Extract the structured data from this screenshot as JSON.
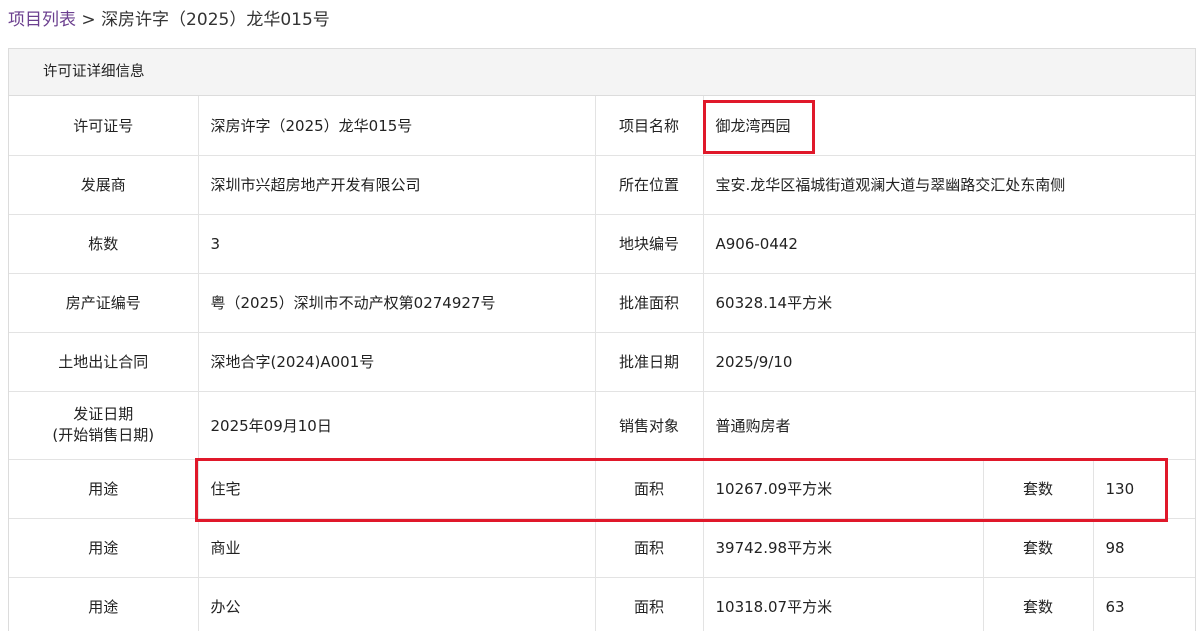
{
  "breadcrumb": {
    "link": "项目列表",
    "separator": ">",
    "current": "深房许字（2025）龙华015号"
  },
  "panel": {
    "title": "许可证详细信息"
  },
  "info_rows": [
    {
      "l1": "许可证号",
      "v1": "深房许字（2025）龙华015号",
      "l2": "项目名称",
      "v2": "御龙湾西园"
    },
    {
      "l1": "发展商",
      "v1": "深圳市兴超房地产开发有限公司",
      "l2": "所在位置",
      "v2": "宝安.龙华区福城街道观澜大道与翠幽路交汇处东南侧"
    },
    {
      "l1": "栋数",
      "v1": "3",
      "l2": "地块编号",
      "v2": "A906-0442"
    },
    {
      "l1": "房产证编号",
      "v1": "粤（2025）深圳市不动产权第0274927号",
      "l2": "批准面积",
      "v2": "60328.14平方米"
    },
    {
      "l1": "土地出让合同",
      "v1": "深地合字(2024)A001号",
      "l2": "批准日期",
      "v2": "2025/9/10"
    },
    {
      "l1": "发证日期",
      "l1b": "(开始销售日期)",
      "v1": "2025年09月10日",
      "l2": "销售对象",
      "v2": "普通购房者"
    }
  ],
  "usage_rows": [
    {
      "use_label": "用途",
      "use": "住宅",
      "area_label": "面积",
      "area": "10267.09平方米",
      "units_label": "套数",
      "units": "130"
    },
    {
      "use_label": "用途",
      "use": "商业",
      "area_label": "面积",
      "area": "39742.98平方米",
      "units_label": "套数",
      "units": "98"
    },
    {
      "use_label": "用途",
      "use": "办公",
      "area_label": "面积",
      "area": "10318.07平方米",
      "units_label": "套数",
      "units": "63"
    }
  ],
  "colors": {
    "link": "#6b3f8f",
    "highlight_box": "#e0182a",
    "header_bg": "#f4f4f4",
    "border": "#e3e3e3"
  }
}
